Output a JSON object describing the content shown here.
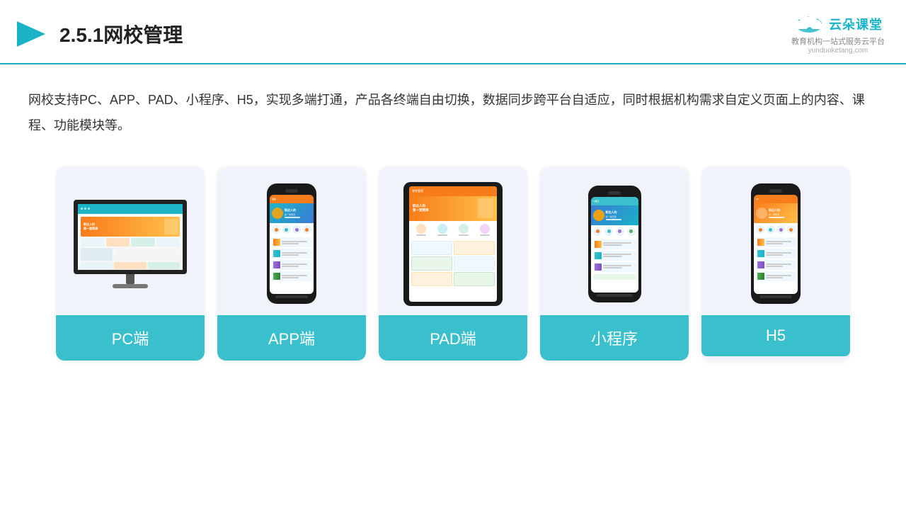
{
  "header": {
    "title": "2.5.1网校管理",
    "logo_name": "云朵课堂",
    "logo_sub": "教育机构一站式服务云平台",
    "logo_url": "yunduoketang.com"
  },
  "description": {
    "text": "网校支持PC、APP、PAD、小程序、H5，实现多端打通，产品各终端自由切换，数据同步跨平台自适应，同时根据机构需求自定义页面上的内容、课程、功能模块等。"
  },
  "cards": [
    {
      "label": "PC端",
      "type": "pc"
    },
    {
      "label": "APP端",
      "type": "phone"
    },
    {
      "label": "PAD端",
      "type": "tablet"
    },
    {
      "label": "小程序",
      "type": "mini-phone"
    },
    {
      "label": "H5",
      "type": "h5-phone"
    }
  ],
  "colors": {
    "accent": "#3abfcc",
    "header_border": "#1ab3c8",
    "title": "#222222",
    "text": "#333333"
  }
}
